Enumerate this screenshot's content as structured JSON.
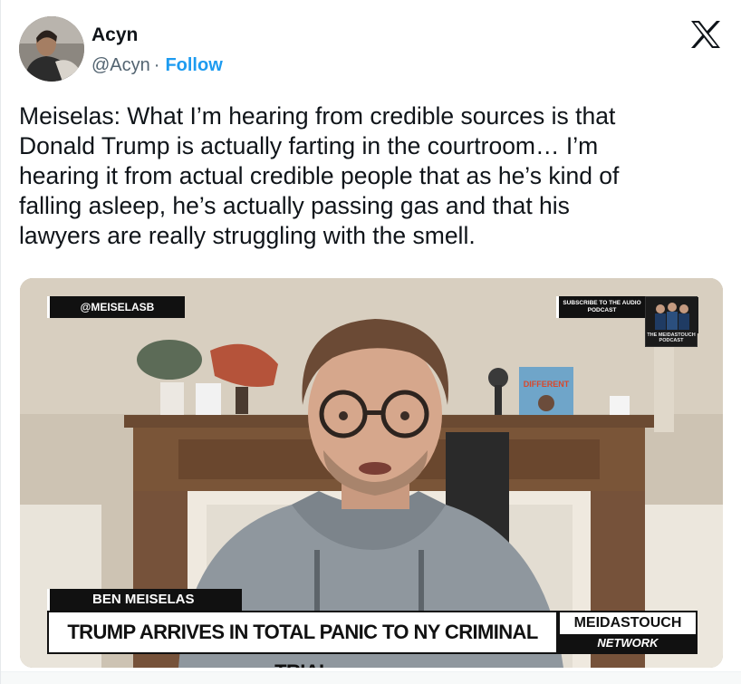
{
  "author": {
    "name": "Acyn",
    "handle": "@Acyn",
    "separator": "·",
    "follow_label": "Follow"
  },
  "brand_icon": "x-logo-icon",
  "tweet": {
    "lines": [
      "Meiselas: What I’m hearing from credible sources is that",
      "Donald Trump is actually farting in the courtroom… I’m",
      "hearing it from actual credible people that as he’s kind of",
      "falling asleep, he’s actually passing gas and that his",
      "lawyers are really struggling with the smell."
    ]
  },
  "video": {
    "handle_tag": "@MEISELASB",
    "subscribe_text": "SUBSCRIBE TO THE AUDIO PODCAST",
    "podcast_label": "THE MEIDASTOUCH PODCAST",
    "book_title": "DIFFERENT",
    "lower_third_name": "BEN MEISELAS",
    "headline": "TRUMP ARRIVES IN TOTAL PANIC TO NY CRIMINAL TRIAL",
    "brand_top": "MEIDASTOUCH",
    "brand_bottom": "NETWORK"
  },
  "colors": {
    "text_primary": "#0f1419",
    "text_secondary": "#536471",
    "accent": "#1d9bf0"
  }
}
